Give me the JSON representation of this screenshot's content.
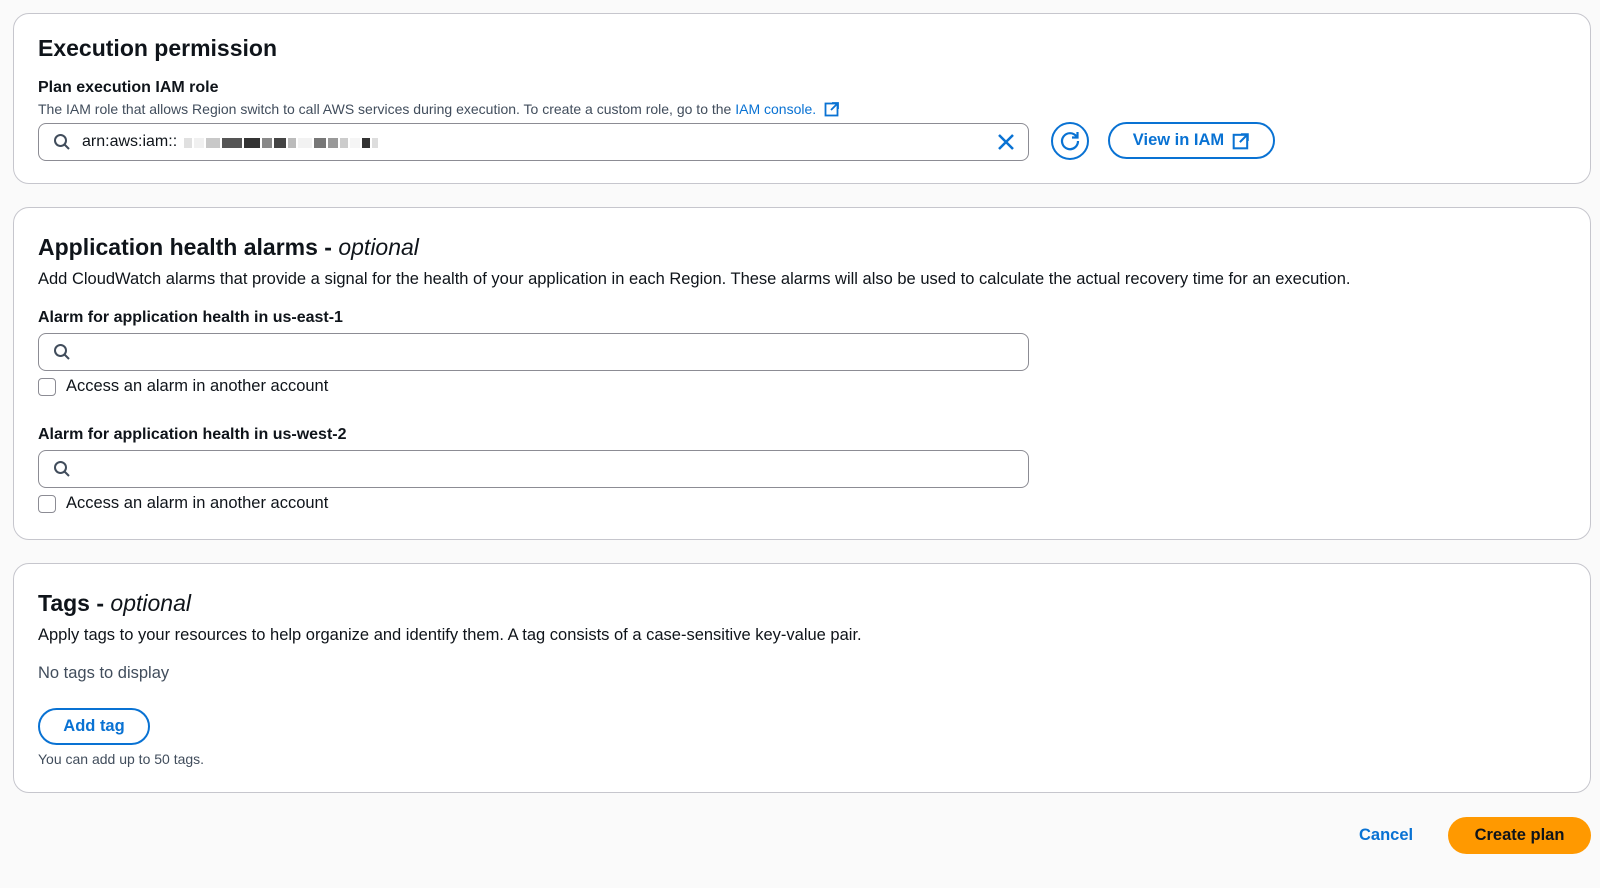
{
  "execution_permission": {
    "title": "Execution permission",
    "role_label": "Plan execution IAM role",
    "role_description": "The IAM role that allows Region switch to call AWS services during execution. To create a custom role, go to the",
    "role_link": "IAM console.",
    "role_value": "arn:aws:iam::",
    "view_button": "View in IAM",
    "icons": {
      "search": "search-icon",
      "clear": "close-icon",
      "refresh": "refresh-icon",
      "external": "external-link-icon"
    }
  },
  "alarms": {
    "title": "Application health alarms - ",
    "title_optional": "optional",
    "description": "Add CloudWatch alarms that provide a signal for the health of your application in each Region. These alarms will also be used to calculate the actual recovery time for an execution.",
    "fields": [
      {
        "label": "Alarm for application health in us-east-1",
        "value": "",
        "checkbox_label": "Access an alarm in another account",
        "checked": false
      },
      {
        "label": "Alarm for application health in us-west-2",
        "value": "",
        "checkbox_label": "Access an alarm in another account",
        "checked": false
      }
    ]
  },
  "tags": {
    "title": "Tags - ",
    "title_optional": "optional",
    "description": "Apply tags to your resources to help organize and identify them. A tag consists of a case-sensitive key-value pair.",
    "empty_text": "No tags to display",
    "add_button": "Add tag",
    "limit_text": "You can add up to 50 tags."
  },
  "footer": {
    "cancel": "Cancel",
    "create": "Create plan"
  },
  "colors": {
    "accent": "#0972d3",
    "primary": "#ff9900",
    "border": "#c6c6cd"
  }
}
